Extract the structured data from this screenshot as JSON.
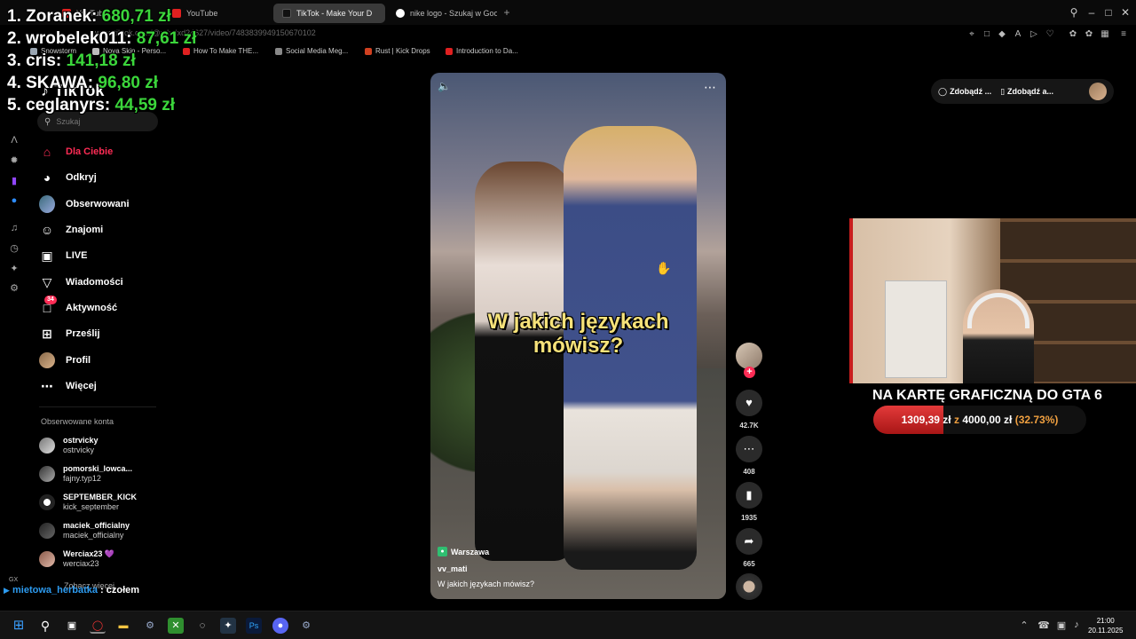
{
  "browser": {
    "tabs": [
      {
        "label": "YouTube",
        "icon": "youtube-icon",
        "active": false
      },
      {
        "label": "YouTube",
        "icon": "youtube-icon",
        "active": false
      },
      {
        "label": "TikTok - Make Your D",
        "icon": "tiktok-icon",
        "active": true
      },
      {
        "label": "nike logo - Szukaj w Goog",
        "icon": "google-icon",
        "active": false
      }
    ],
    "url": "www.tiktok.com/@xdxdxd24627/video/7483839949150670102",
    "bookmarks": [
      {
        "label": "Snowstorm",
        "color": "#9aa6b2"
      },
      {
        "label": "Nova Skin - Perso...",
        "color": "#bbbbbb"
      },
      {
        "label": "How To Make THE...",
        "color": "#e02020"
      },
      {
        "label": "Social Media Meg...",
        "color": "#888888"
      },
      {
        "label": "Rust | Kick Drops",
        "color": "#d04020"
      },
      {
        "label": "Introduction to Da...",
        "color": "#e02020"
      }
    ],
    "rail_label": "GX"
  },
  "leaderboard": [
    {
      "rank_name": "1. Zoranek: ",
      "amount": "680,71 zł"
    },
    {
      "rank_name": "2. wrobelek011: ",
      "amount": "87,61 zł"
    },
    {
      "rank_name": "3. cris: ",
      "amount": "141,18 zł"
    },
    {
      "rank_name": "4. SKAWA: ",
      "amount": "96,80 zł"
    },
    {
      "rank_name": "5. ceglanyrs: ",
      "amount": "44,59 zł"
    }
  ],
  "tiktok": {
    "logo": "TikTok",
    "search_placeholder": "Szukaj",
    "nav": [
      {
        "label": "Dla Ciebie",
        "icon": "home-icon"
      },
      {
        "label": "Odkryj",
        "icon": "compass-icon"
      },
      {
        "label": "Obserwowani",
        "icon": "following-avatar-icon"
      },
      {
        "label": "Znajomi",
        "icon": "friends-icon"
      },
      {
        "label": "LIVE",
        "icon": "live-icon"
      },
      {
        "label": "Wiadomości",
        "icon": "messages-icon"
      },
      {
        "label": "Aktywność",
        "icon": "activity-icon",
        "badge": "34"
      },
      {
        "label": "Prześlij",
        "icon": "upload-icon"
      },
      {
        "label": "Profil",
        "icon": "profile-avatar-icon"
      },
      {
        "label": "Więcej",
        "icon": "more-icon"
      }
    ],
    "followed_title": "Obserwowane konta",
    "followed": [
      {
        "name": "ostrvicky",
        "handle": "ostrvicky"
      },
      {
        "name": "pomorski_lowca...",
        "handle": "fajny.typ12"
      },
      {
        "name": "SEPTEMBER_KICK",
        "handle": "kick_september"
      },
      {
        "name": "maciek_officialny",
        "handle": "maciek_officialny"
      },
      {
        "name": "Werciax23 💜",
        "handle": "werciax23"
      }
    ],
    "see_more": "Zobacz więcej"
  },
  "video": {
    "caption_line1": "W jakich językach",
    "caption_line2": "mówisz?",
    "location": "Warszawa",
    "author": "vv_mati",
    "description": "W jakich językach mówisz?",
    "likes": "42.7K",
    "comments": "408",
    "saves": "1935",
    "shares": "665"
  },
  "top_pills": [
    "Zdobądź ...",
    "Zdobądź a..."
  ],
  "goal": {
    "title": "NA KARTĘ GRAFICZNĄ DO GTA 6",
    "current": "1309,39 zł",
    "separator": " z ",
    "target": "4000,00 zł",
    "percent_label": "(32.73%)",
    "progress": 0.3273,
    "colors": {
      "fill": "#d42a2a",
      "accent": "#f0a040"
    }
  },
  "chat": {
    "user": "mietowa_herbatka",
    "separator": " : ",
    "message": "czołem"
  },
  "taskbar": {
    "time": "21:00",
    "date": "20.11.2025"
  }
}
